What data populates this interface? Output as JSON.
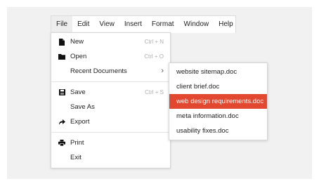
{
  "menubar": {
    "items": [
      "File",
      "Edit",
      "View",
      "Insert",
      "Format",
      "Window",
      "Help"
    ]
  },
  "file_menu": {
    "new": {
      "label": "New",
      "shortcut": "Ctrl + N",
      "icon": "document-icon"
    },
    "open": {
      "label": "Open",
      "shortcut": "Ctrl + O",
      "icon": "folder-icon"
    },
    "recent": {
      "label": "Recent Documents",
      "arrow": "›"
    },
    "save": {
      "label": "Save",
      "shortcut": "Ctrl + S",
      "icon": "floppy-disk-icon"
    },
    "save_as": {
      "label": "Save As"
    },
    "export": {
      "label": "Export",
      "icon": "export-arrow-icon"
    },
    "print": {
      "label": "Print",
      "icon": "printer-icon"
    },
    "exit": {
      "label": "Exit"
    }
  },
  "recent_documents": {
    "items": [
      "website sitemap.doc",
      "client brief.doc",
      "web design requirements.doc",
      "meta information.doc",
      "usability fixes.doc"
    ],
    "highlighted": "web design requirements.doc",
    "highlight_color": "#e2472f"
  }
}
